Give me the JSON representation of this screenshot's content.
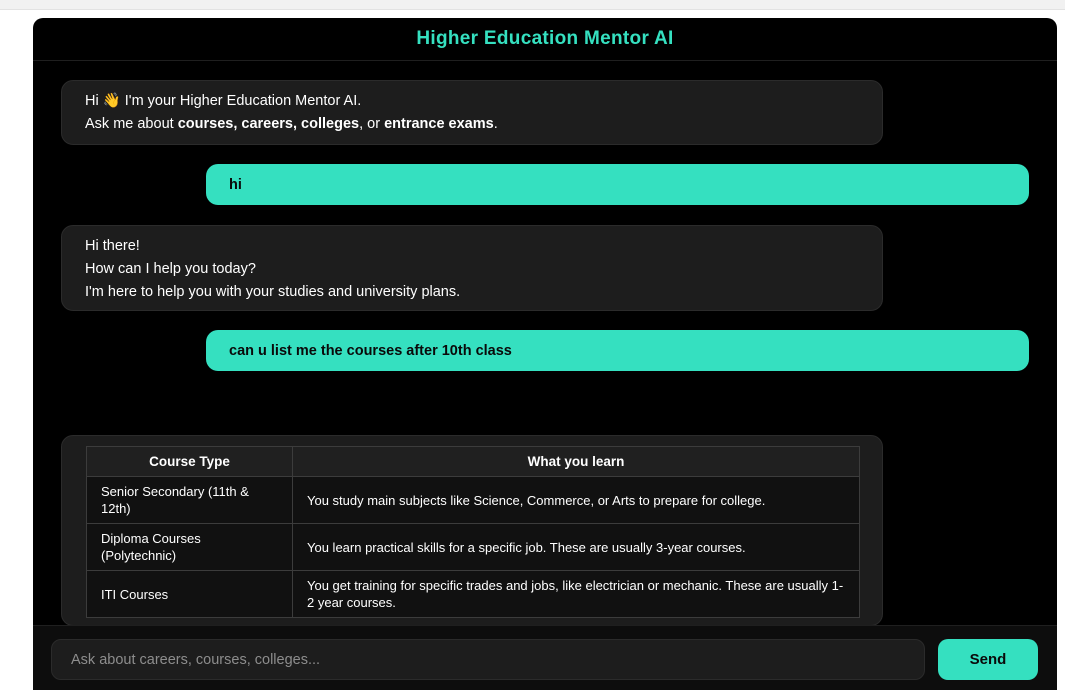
{
  "header": {
    "title": "Higher Education Mentor AI"
  },
  "messages": {
    "welcome": {
      "greeting": "Hi",
      "wave_icon": "👋",
      "intro": "I'm your Higher Education Mentor AI.",
      "ask_prefix": "Ask me about",
      "topic_courses": "courses, careers, colleges",
      "or": ", or",
      "topic_exams": "entrance exams",
      "period": "."
    },
    "user_1": "hi",
    "reply_1": {
      "line1": "Hi there!",
      "line2": "How can I help you today?",
      "line3": "I'm here to help you with your studies and university plans."
    },
    "user_2": "can u list me the courses after 10th class",
    "table": {
      "headers": [
        "Course Type",
        "What you learn"
      ],
      "rows": [
        [
          "Senior Secondary (11th & 12th)",
          "You study main subjects like Science, Commerce, or Arts to prepare for college."
        ],
        [
          "Diploma Courses (Polytechnic)",
          "You learn practical skills for a specific job. These are usually 3-year courses."
        ],
        [
          "ITI Courses",
          "You get training for specific trades and jobs, like electrician or mechanic. These are usually 1-2 year courses."
        ]
      ]
    }
  },
  "composer": {
    "placeholder": "Ask about careers, courses, colleges...",
    "send_label": "Send"
  },
  "colors": {
    "accent": "#35e0c0",
    "background": "#000000",
    "bubble": "#1d1d1d"
  }
}
